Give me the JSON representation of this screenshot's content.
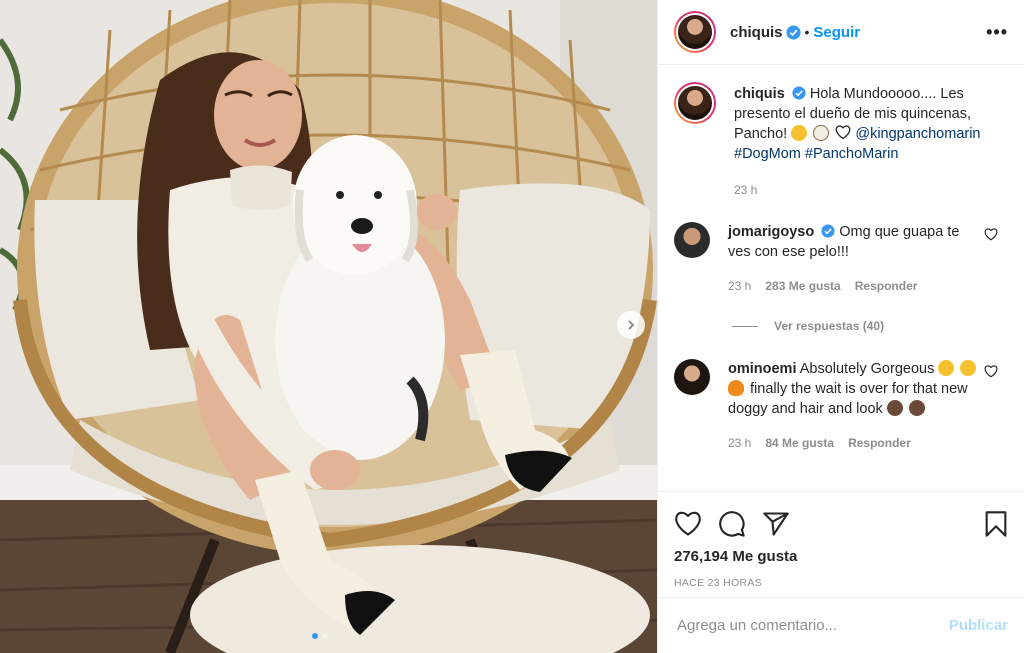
{
  "post": {
    "username": "chiquis",
    "verified": true,
    "follow_label": "Seguir",
    "separator": "•",
    "more_label": "•••",
    "carousel": {
      "slides": 2,
      "active": 1
    }
  },
  "caption": {
    "username": "chiquis",
    "text": "Hola Mundooooo.... Les presento el dueño de mis quincenas, Pancho!",
    "mention": "@kingpanchomarin",
    "hashtags": [
      "#DogMom",
      "#PanchoMarin"
    ],
    "time": "23 h"
  },
  "comments": [
    {
      "username": "jomarigoyso",
      "verified": true,
      "text": "Omg que guapa te ves con ese pelo!!!",
      "time": "23 h",
      "likes": "283 Me gusta",
      "reply": "Responder",
      "replies_label": "Ver respuestas (40)"
    },
    {
      "username": "ominoemi",
      "verified": false,
      "text_before": "Absolutely Gorgeous",
      "text_after": "finally the wait is over for that new doggy and hair and look",
      "time": "23 h",
      "likes": "84 Me gusta",
      "reply": "Responder"
    }
  ],
  "actions": {
    "like_icon": "heart-icon",
    "comment_icon": "comment-icon",
    "share_icon": "paper-plane-icon",
    "save_icon": "bookmark-icon"
  },
  "likes": "276,194 Me gusta",
  "timestamp": "HACE 23 HORAS",
  "comment_box": {
    "placeholder": "Agrega un comentario...",
    "publish_label": "Publicar"
  },
  "colors": {
    "accent": "#0095f6",
    "link": "#00376b",
    "muted": "#8e8e8e",
    "publish_disabled": "#b2dffc"
  }
}
